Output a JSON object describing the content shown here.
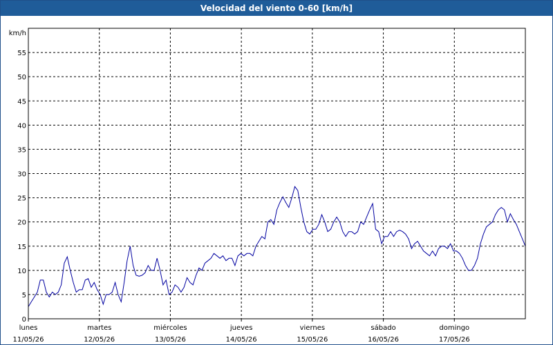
{
  "window": {
    "title": "Velocidad del viento 0-60 [km/h]"
  },
  "chart_data": {
    "type": "line",
    "title": "Velocidad del viento 0-60 [km/h]",
    "ylabel": "km/h",
    "xlabel": "",
    "ylim": [
      0,
      60
    ],
    "yticks": [
      0,
      5,
      10,
      15,
      20,
      25,
      30,
      35,
      40,
      45,
      50,
      55
    ],
    "xlim": [
      0,
      7.0
    ],
    "grid": true,
    "line_color": "#0000a0",
    "day_labels": [
      {
        "day": "lunes",
        "date": "11/05/26"
      },
      {
        "day": "martes",
        "date": "12/05/26"
      },
      {
        "day": "miércoles",
        "date": "13/05/26"
      },
      {
        "day": "jueves",
        "date": "14/05/26"
      },
      {
        "day": "viernes",
        "date": "15/05/26"
      },
      {
        "day": "sábado",
        "date": "16/05/26"
      },
      {
        "day": "domingo",
        "date": "17/05/26"
      }
    ],
    "series": [
      {
        "values": [
          2.5,
          3.5,
          4.5,
          5.5,
          8.0,
          8.0,
          5.5,
          4.5,
          5.5,
          5.0,
          5.5,
          7.0,
          11.5,
          12.8,
          10.0,
          7.5,
          5.5,
          6.0,
          6.0,
          8.0,
          8.3,
          6.5,
          7.5,
          6.0,
          5.0,
          3.0,
          5.0,
          5.0,
          5.5,
          7.5,
          5.0,
          3.5,
          7.5,
          12.0,
          15.0,
          11.0,
          9.0,
          8.8,
          9.0,
          9.5,
          11.0,
          10.0,
          10.0,
          12.5,
          10.0,
          7.0,
          8.0,
          5.0,
          5.5,
          7.0,
          6.5,
          5.5,
          6.5,
          8.5,
          7.5,
          7.0,
          9.0,
          10.5,
          10.0,
          11.5,
          12.0,
          12.5,
          13.5,
          13.0,
          12.5,
          13.0,
          12.0,
          12.5,
          12.5,
          11.0,
          13.0,
          13.5,
          13.0,
          13.5,
          13.5,
          13.0,
          15.0,
          16.0,
          17.0,
          16.5,
          20.0,
          20.5,
          19.5,
          22.5,
          24.0,
          25.2,
          24.0,
          23.0,
          25.0,
          27.3,
          26.5,
          23.0,
          20.0,
          18.0,
          17.5,
          18.5,
          18.5,
          19.5,
          21.5,
          20.0,
          18.0,
          18.5,
          20.0,
          21.0,
          20.0,
          18.0,
          17.0,
          18.0,
          18.0,
          17.5,
          18.0,
          20.0,
          19.5,
          21.0,
          22.5,
          23.8,
          18.5,
          18.0,
          15.5,
          17.0,
          17.0,
          18.0,
          17.0,
          18.0,
          18.3,
          18.0,
          17.5,
          16.5,
          14.5,
          15.5,
          16.0,
          15.0,
          14.0,
          13.5,
          13.0,
          14.0,
          13.0,
          14.5,
          15.0,
          15.0,
          14.5,
          15.5,
          14.0,
          14.0,
          13.5,
          12.5,
          11.0,
          10.0,
          10.0,
          11.0,
          12.5,
          15.5,
          17.5,
          19.0,
          19.5,
          20.0,
          21.5,
          22.5,
          23.0,
          22.5,
          20.0,
          21.7,
          20.5,
          19.5,
          18.0,
          16.5,
          15.0
        ]
      }
    ]
  }
}
